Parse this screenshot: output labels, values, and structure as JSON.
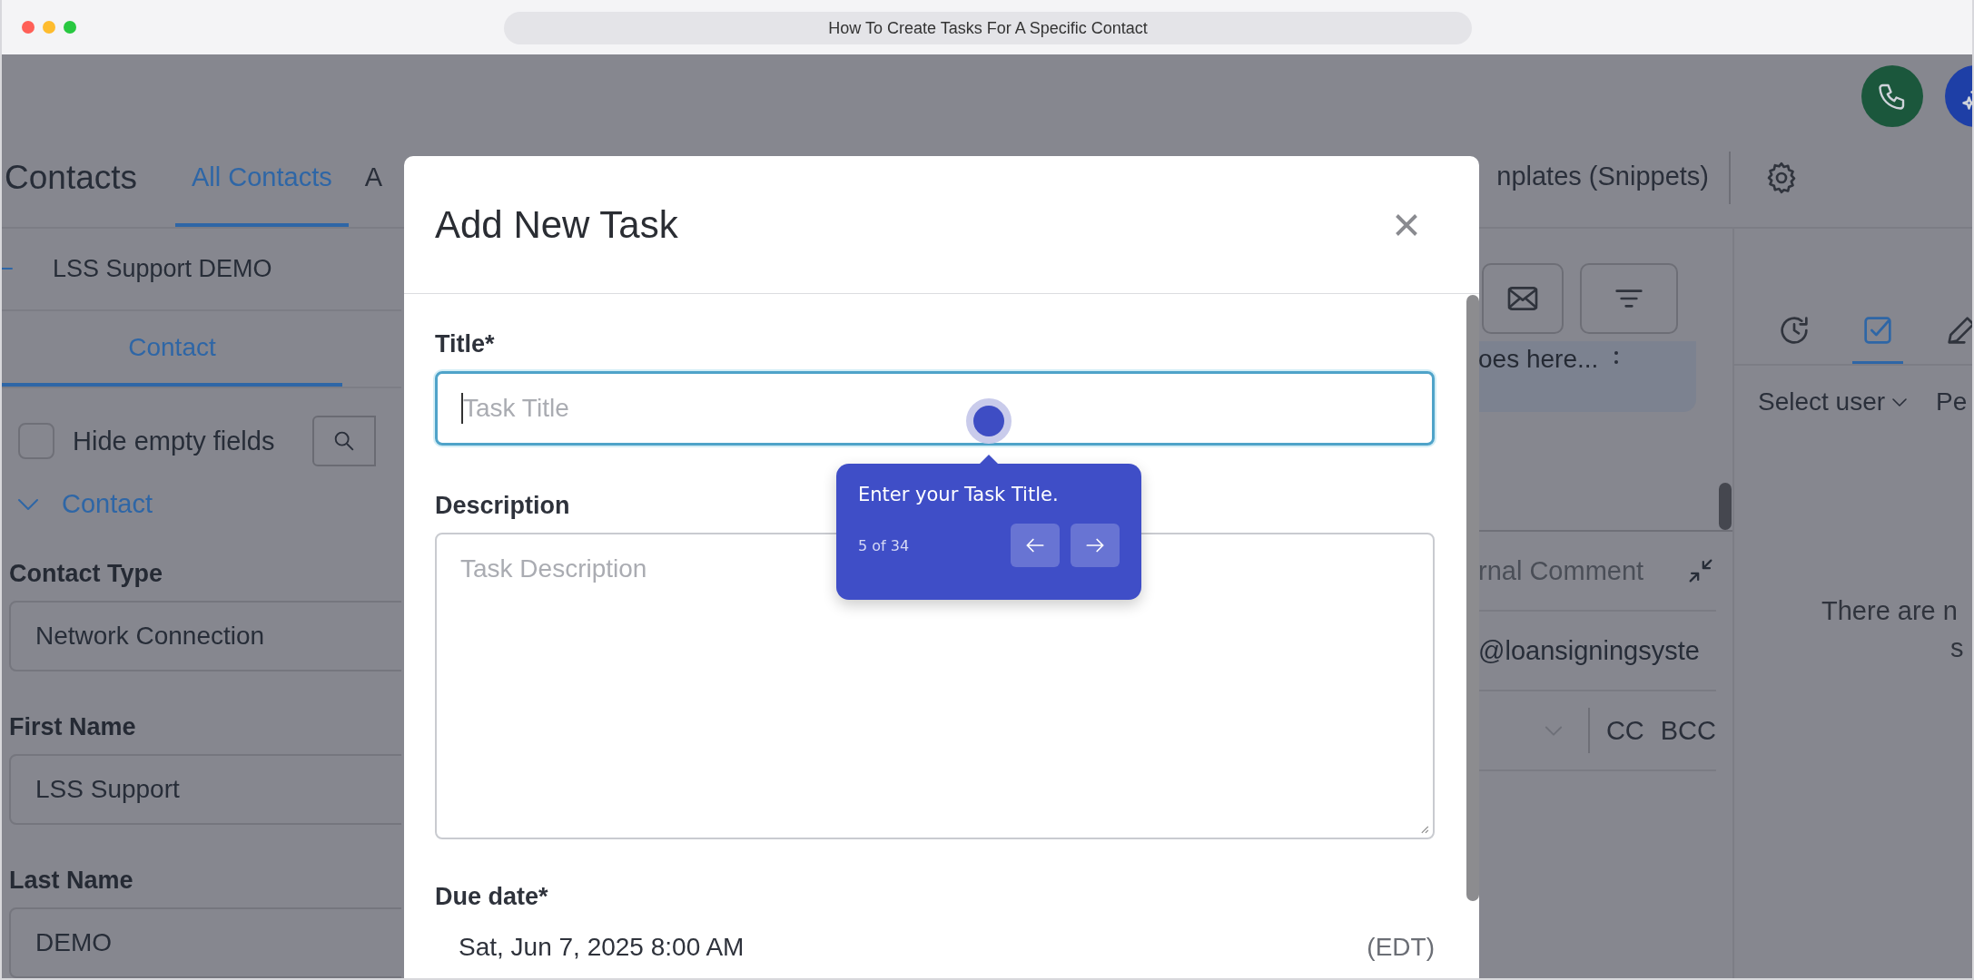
{
  "window": {
    "title": "How To Create Tasks For A Specific Contact"
  },
  "floating_buttons": [
    {
      "kind": "phone"
    },
    {
      "kind": "sparkle"
    }
  ],
  "header": {
    "title": "Contacts",
    "tabs": [
      {
        "label": "All Contacts",
        "selected": true
      },
      {
        "label": "A",
        "selected": false
      }
    ],
    "right_tab": "nplates (Snippets)"
  },
  "contact_panel": {
    "back_title": "LSS Support DEMO",
    "tabs": [
      {
        "label": "Contact",
        "selected": true
      }
    ],
    "hide_empty": {
      "label": "Hide empty fields",
      "checked": false
    },
    "section": {
      "label": "Contact",
      "expanded": true
    },
    "fields": [
      {
        "label": "Contact Type",
        "value": "Network Connection"
      },
      {
        "label": "First Name",
        "value": "LSS Support"
      },
      {
        "label": "Last Name",
        "value": "DEMO"
      }
    ]
  },
  "middle": {
    "note": "oes here...",
    "comment_label": "rnal Comment",
    "from": "@loansigningsyste",
    "cc": "CC",
    "bcc": "BCC"
  },
  "activity_panel": {
    "tabs": [
      {
        "kind": "history",
        "selected": false
      },
      {
        "kind": "tasks",
        "selected": true
      },
      {
        "kind": "notes",
        "selected": false
      }
    ],
    "user_filter": "Select user",
    "filter_2": "Pe",
    "empty_lines": [
      "There are n",
      "s"
    ]
  },
  "modal": {
    "title": "Add New Task",
    "fields": [
      {
        "kind": "input",
        "label": "Title*",
        "placeholder": "Task Title",
        "focused": true
      },
      {
        "kind": "textarea",
        "label": "Description",
        "placeholder": "Task Description"
      },
      {
        "kind": "datetime",
        "label": "Due date*",
        "value": "Sat, Jun 7, 2025 8:00 AM",
        "timezone": "(EDT)"
      }
    ]
  },
  "tour": {
    "text": "Enter your Task Title.",
    "step": "5 of 34"
  }
}
